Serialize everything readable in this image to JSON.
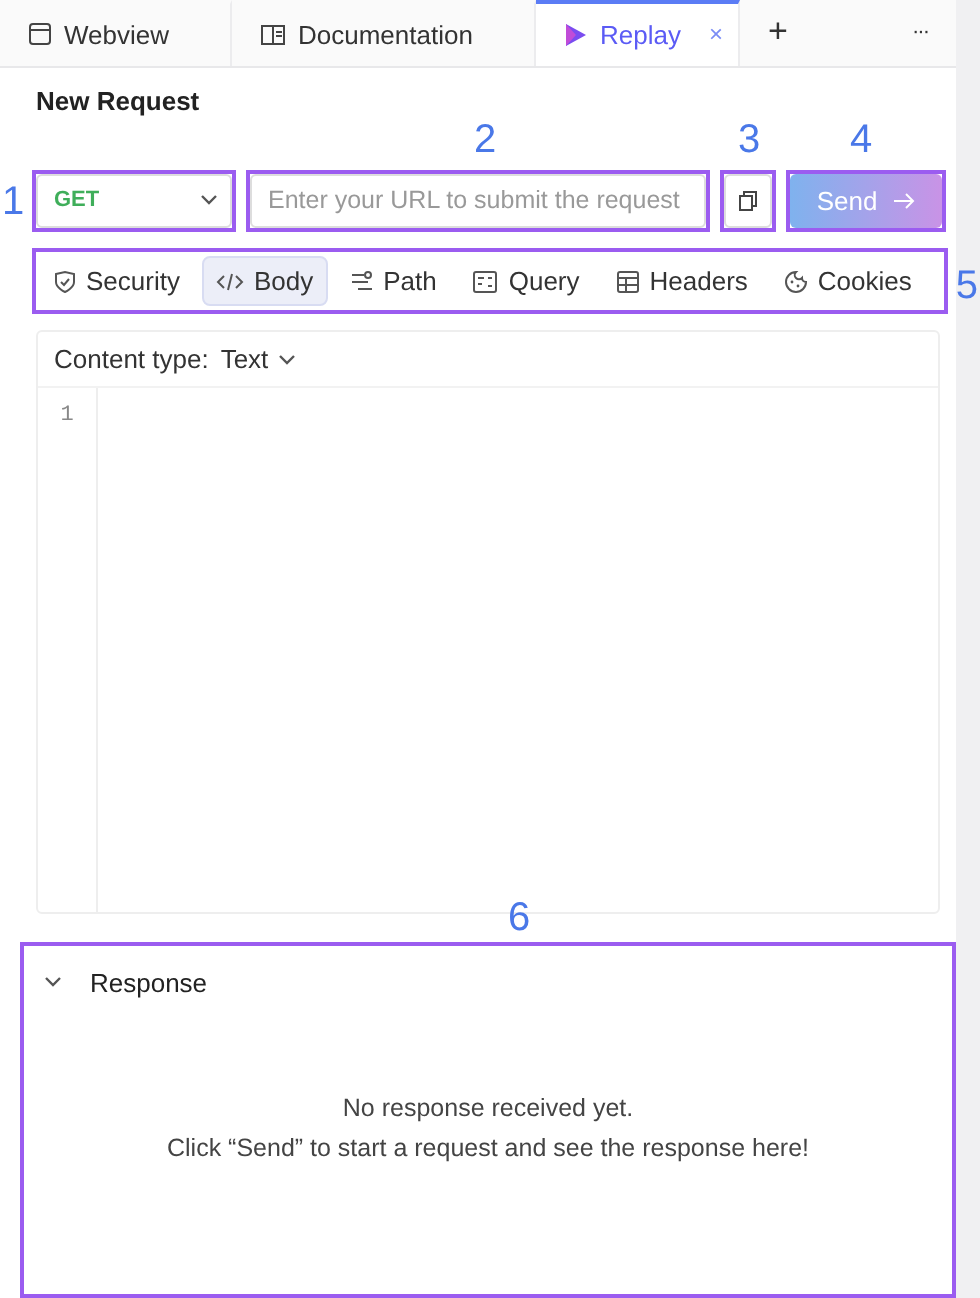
{
  "tabs": [
    {
      "label": "Webview",
      "selected": false
    },
    {
      "label": "Documentation",
      "selected": false
    },
    {
      "label": "Replay",
      "selected": true,
      "close": "×"
    }
  ],
  "tab_add": "+",
  "tab_more": "···",
  "title": "New Request",
  "request": {
    "method": "GET",
    "url_placeholder": "Enter your URL to submit the request",
    "send": "Send"
  },
  "sections": [
    {
      "label": "Security",
      "selected": false
    },
    {
      "label": "Body",
      "selected": true
    },
    {
      "label": "Path",
      "selected": false
    },
    {
      "label": "Query",
      "selected": false
    },
    {
      "label": "Headers",
      "selected": false
    },
    {
      "label": "Cookies",
      "selected": false
    }
  ],
  "editor": {
    "content_type_label": "Content type:",
    "content_type": "Text",
    "line_numbers": [
      "1"
    ]
  },
  "response": {
    "title": "Response",
    "expanded": true,
    "empty_lines": [
      "No response received yet.",
      "Click “Send” to start a request and see the response here!"
    ]
  },
  "annotations": [
    "1",
    "2",
    "3",
    "4",
    "5",
    "6"
  ]
}
